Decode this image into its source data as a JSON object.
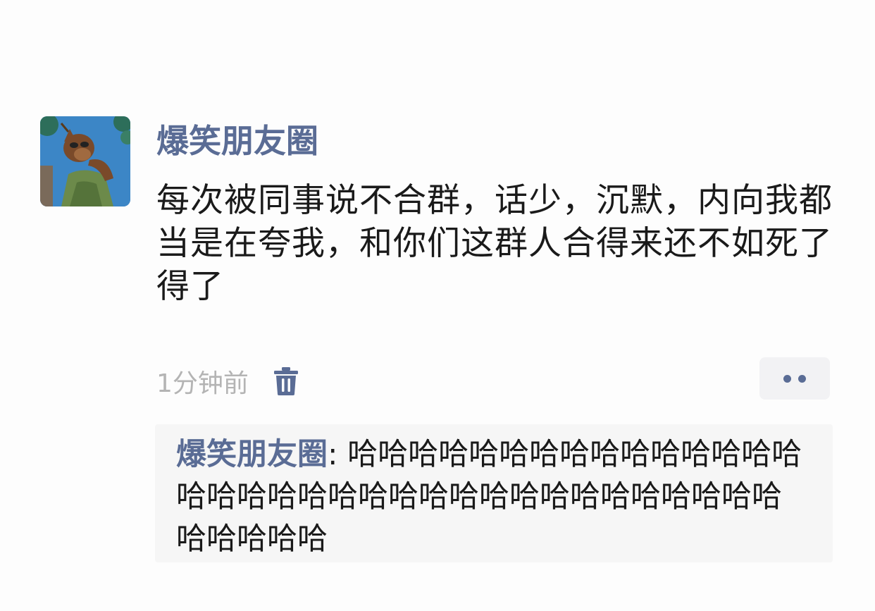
{
  "post": {
    "author": "爆笑朋友圈",
    "content": "每次被同事说不合群，话少，沉默，内向我都当是在夸我，和你们这群人合得来还不如死了得了",
    "time": "1分钟前",
    "delete_icon": "trash-icon",
    "more_icon": "two-dots-icon"
  },
  "comments": [
    {
      "author": "爆笑朋友圈",
      "separator": ": ",
      "text": "哈哈哈哈哈哈哈哈哈哈哈哈哈哈哈哈哈哈哈哈哈哈哈哈哈哈哈哈哈哈哈哈哈哈哈哈哈哈哈哈"
    }
  ],
  "colors": {
    "link_blue": "#5a6c95",
    "text": "#1a1a1a",
    "muted": "#b4b4b4",
    "comment_bg": "#f6f6f6"
  }
}
